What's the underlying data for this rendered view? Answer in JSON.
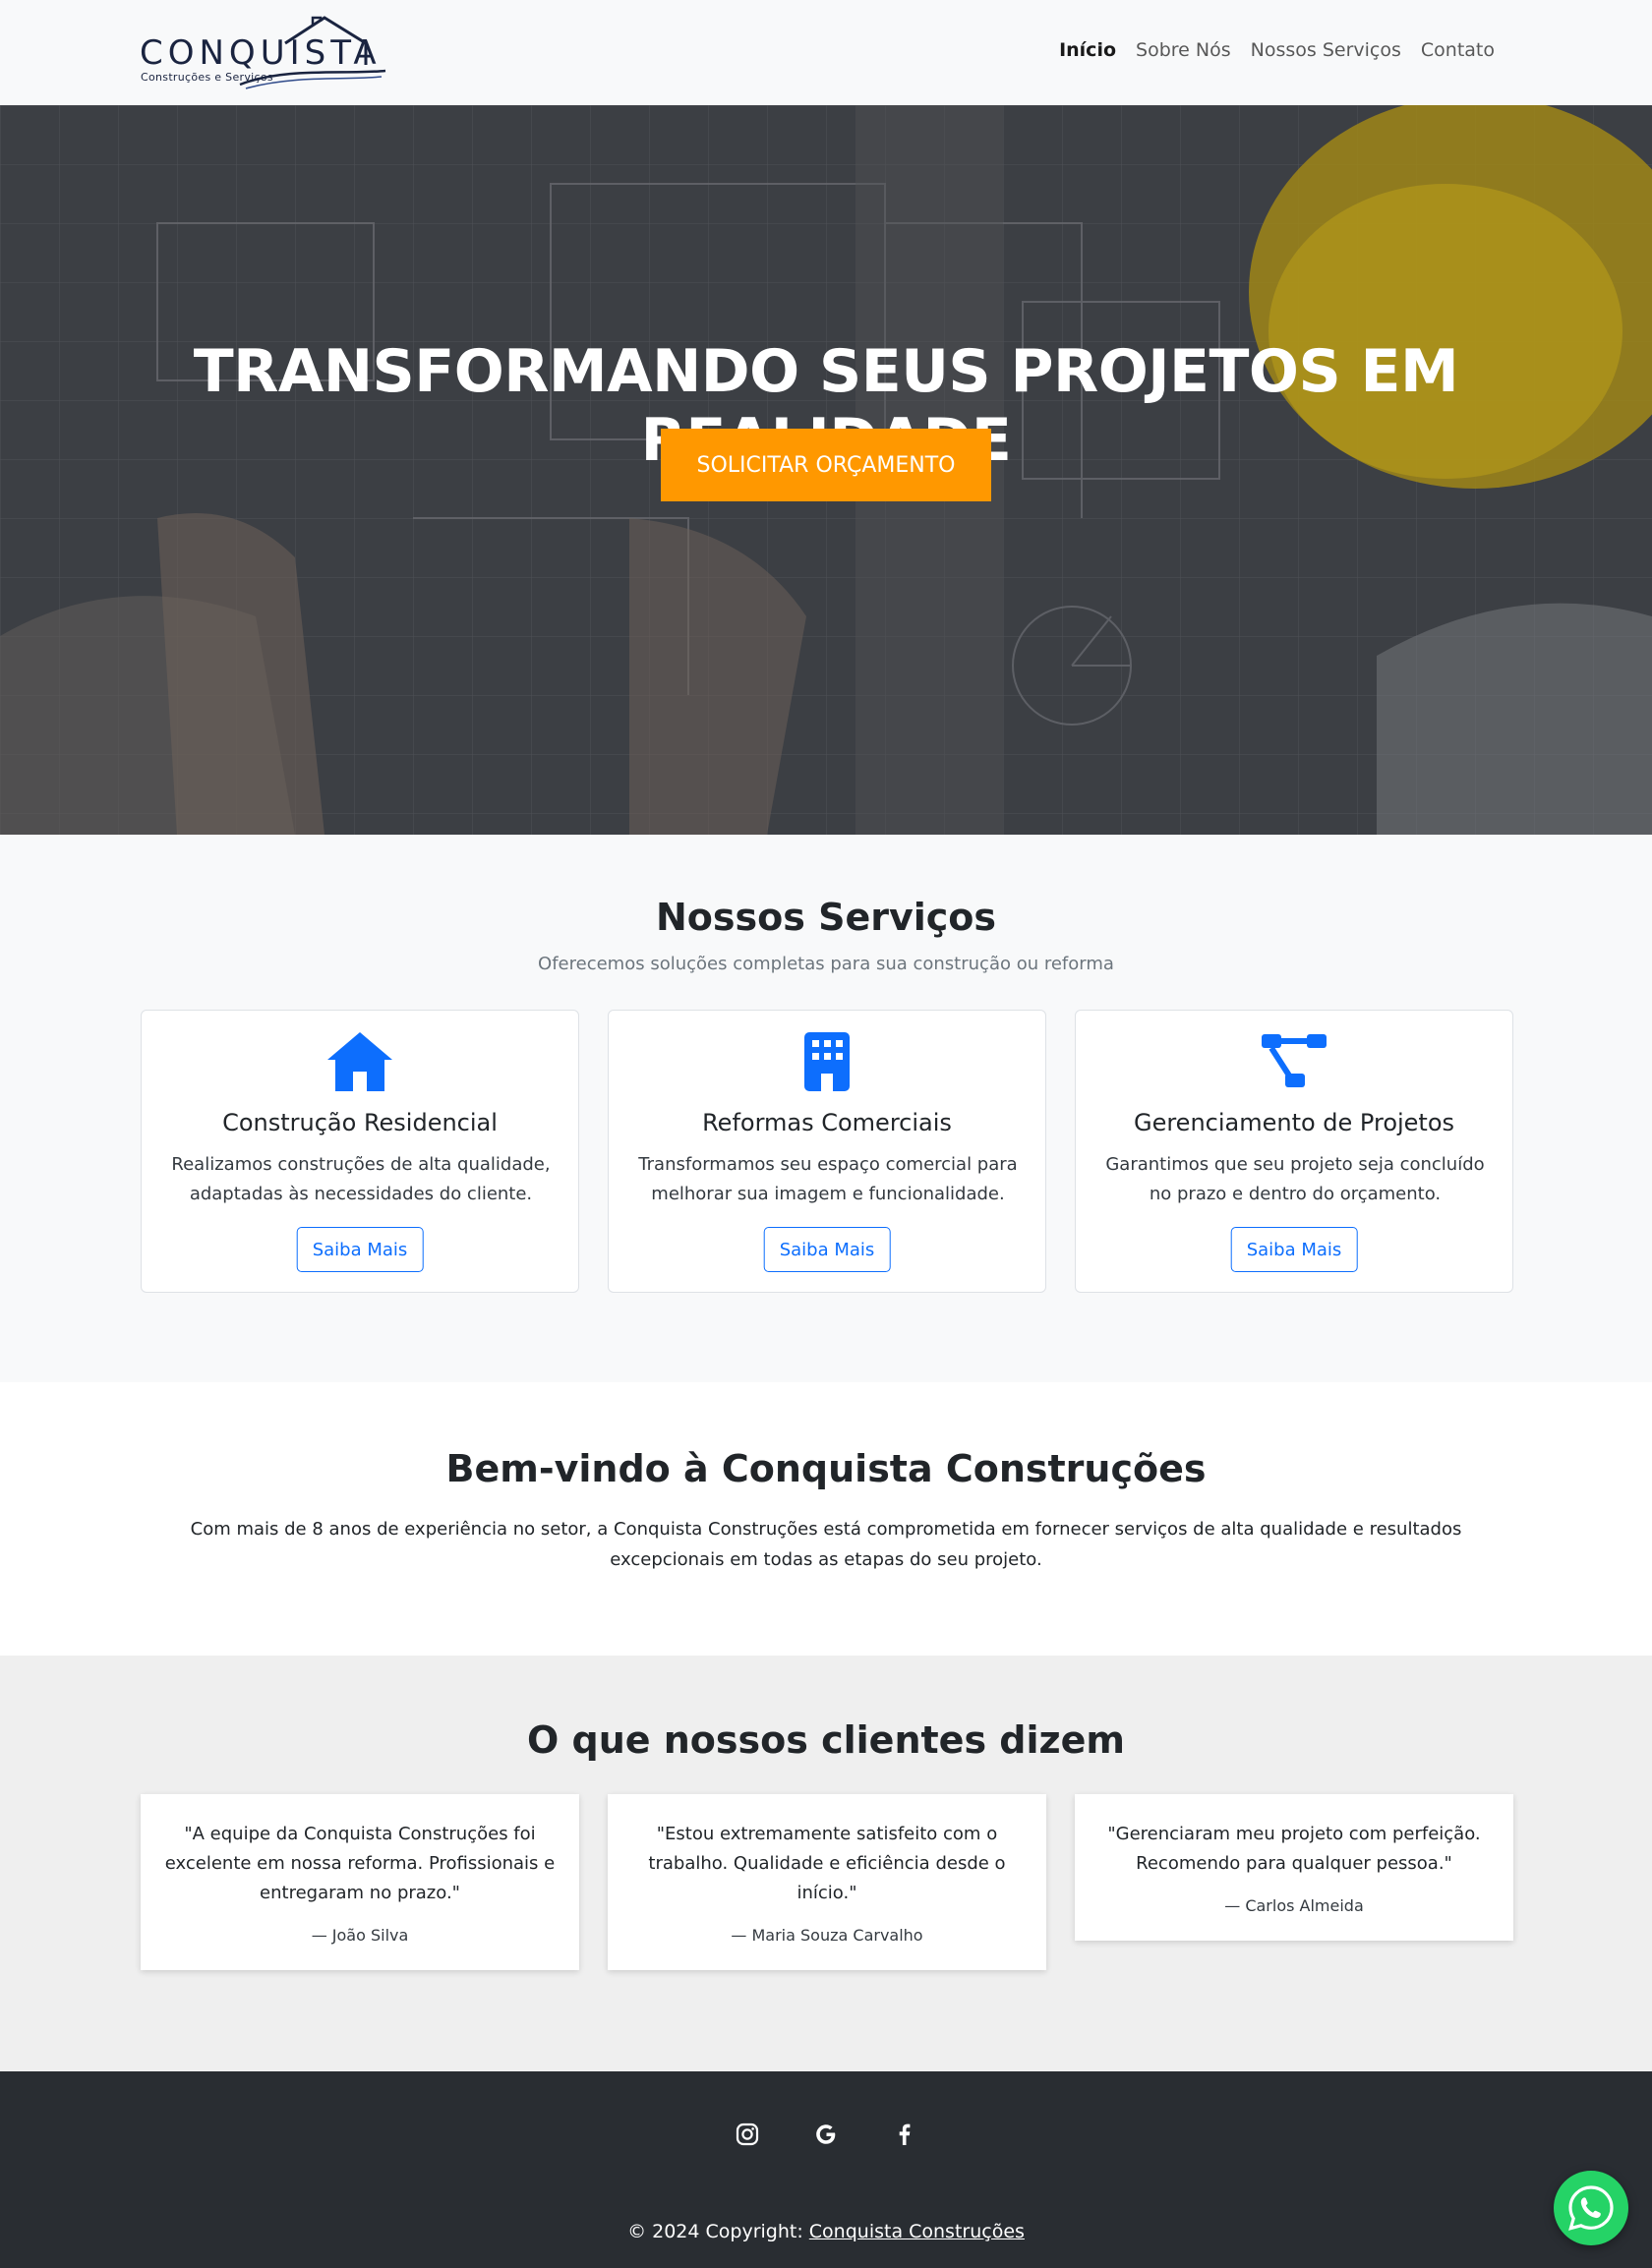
{
  "brand": {
    "name": "CONQUISTA",
    "tagline": "Construções e Serviços"
  },
  "nav": {
    "items": [
      {
        "label": "Início",
        "active": true
      },
      {
        "label": "Sobre Nós",
        "active": false
      },
      {
        "label": "Nossos Serviços",
        "active": false
      },
      {
        "label": "Contato",
        "active": false
      }
    ]
  },
  "hero": {
    "title": "TRANSFORMANDO SEUS PROJETOS EM REALIDADE",
    "cta_label": "SOLICITAR ORÇAMENTO"
  },
  "services": {
    "title": "Nossos Serviços",
    "subtitle": "Oferecemos soluções completas para sua construção ou reforma",
    "items": [
      {
        "icon": "house-icon",
        "title": "Construção Residencial",
        "text": "Realizamos construções de alta qualidade, adaptadas às necessidades do cliente.",
        "button": "Saiba Mais"
      },
      {
        "icon": "building-icon",
        "title": "Reformas Comerciais",
        "text": "Transformamos seu espaço comercial para melhorar sua imagem e funcionalidade.",
        "button": "Saiba Mais"
      },
      {
        "icon": "project-diagram-icon",
        "title": "Gerenciamento de Projetos",
        "text": "Garantimos que seu projeto seja concluído no prazo e dentro do orçamento.",
        "button": "Saiba Mais"
      }
    ]
  },
  "about": {
    "title": "Bem-vindo à Conquista Construções",
    "text": "Com mais de 8 anos de experiência no setor, a Conquista Construções está comprometida em fornecer serviços de alta qualidade e resultados excepcionais em todas as etapas do seu projeto."
  },
  "testimonials": {
    "title": "O que nossos clientes dizem",
    "items": [
      {
        "quote": "\"A equipe da Conquista Construções foi excelente em nossa reforma. Profissionais e entregaram no prazo.\"",
        "author": "— João Silva"
      },
      {
        "quote": "\"Estou extremamente satisfeito com o trabalho. Qualidade e eficiência desde o início.\"",
        "author": "— Maria Souza Carvalho"
      },
      {
        "quote": "\"Gerenciaram meu projeto com perfeição. Recomendo para qualquer pessoa.\"",
        "author": "— Carlos Almeida"
      }
    ]
  },
  "footer": {
    "social": [
      "instagram-icon",
      "google-icon",
      "facebook-icon"
    ],
    "copyright_prefix": "© 2024 Copyright: ",
    "copyright_link": "Conquista Construções"
  },
  "colors": {
    "accent": "#ff9800",
    "primary": "#0d6efd",
    "footer_bg": "#292d32",
    "whatsapp": "#25d366"
  }
}
